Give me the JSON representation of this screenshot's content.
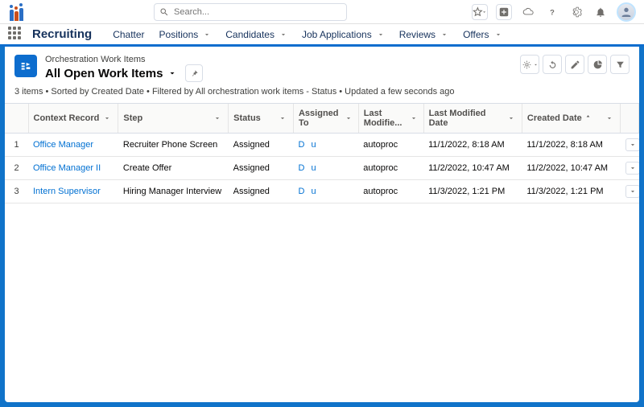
{
  "search": {
    "placeholder": "Search..."
  },
  "app": {
    "name": "Recruiting"
  },
  "nav": [
    {
      "label": "Chatter",
      "has_menu": false
    },
    {
      "label": "Positions",
      "has_menu": true
    },
    {
      "label": "Candidates",
      "has_menu": true
    },
    {
      "label": "Job Applications",
      "has_menu": true
    },
    {
      "label": "Reviews",
      "has_menu": true
    },
    {
      "label": "Offers",
      "has_menu": true
    }
  ],
  "header": {
    "object_type": "Orchestration Work Items",
    "list_view": "All Open Work Items"
  },
  "list_meta": "3 items • Sorted by Created Date • Filtered by All orchestration work items - Status • Updated a few seconds ago",
  "columns": {
    "context": "Context Record",
    "step": "Step",
    "status": "Status",
    "assigned_to": "Assigned To",
    "last_modified_by": "Last Modifie...",
    "last_modified_date": "Last Modified Date",
    "created_date": "Created Date"
  },
  "rows": [
    {
      "num": "1",
      "context": "Office Manager",
      "step": "Recruiter Phone Screen",
      "status": "Assigned",
      "assigned_a": "D",
      "assigned_b": "u",
      "last_mod_by": "autoproc",
      "last_mod_date": "11/1/2022, 8:18 AM",
      "created_date": "11/1/2022, 8:18 AM"
    },
    {
      "num": "2",
      "context": "Office Manager II",
      "step": "Create Offer",
      "status": "Assigned",
      "assigned_a": "D",
      "assigned_b": "u",
      "last_mod_by": "autoproc",
      "last_mod_date": "11/2/2022, 10:47 AM",
      "created_date": "11/2/2022, 10:47 AM"
    },
    {
      "num": "3",
      "context": "Intern Supervisor",
      "step": "Hiring Manager Interview",
      "status": "Assigned",
      "assigned_a": "D",
      "assigned_b": "u",
      "last_mod_by": "autoproc",
      "last_mod_date": "11/3/2022, 1:21 PM",
      "created_date": "11/3/2022, 1:21 PM"
    }
  ]
}
